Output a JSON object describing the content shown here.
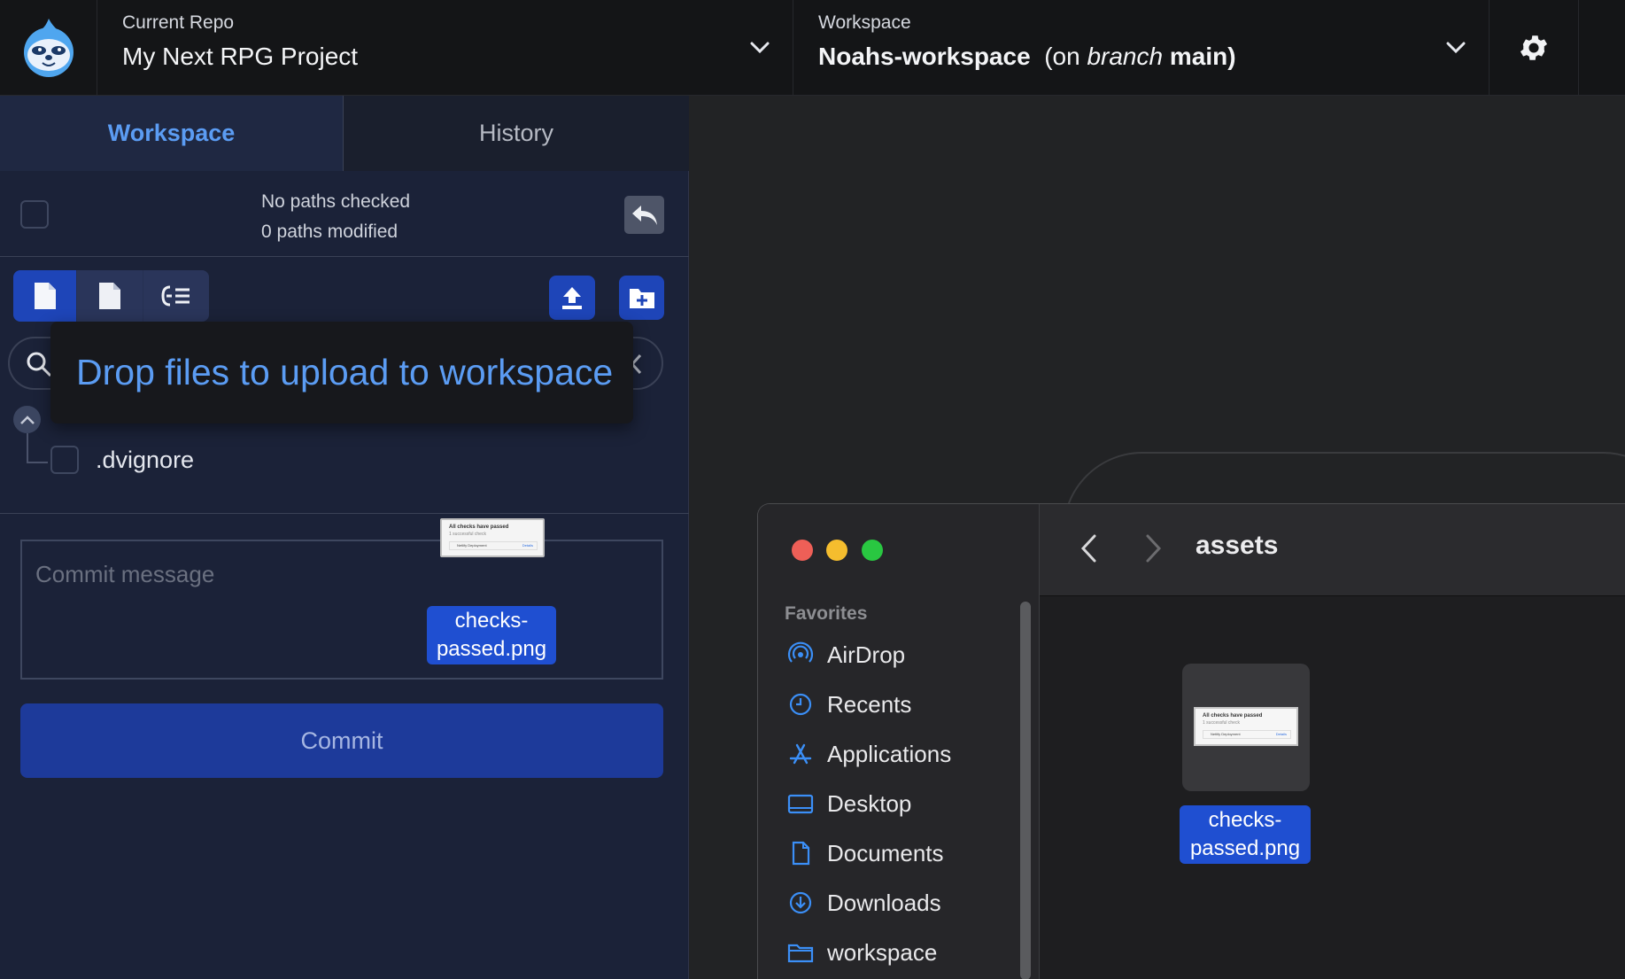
{
  "topbar": {
    "repo_label": "Current Repo",
    "repo_value": "My Next RPG Project",
    "workspace_label": "Workspace",
    "workspace_name": "Noahs-workspace",
    "workspace_branch_prefix": "(on",
    "workspace_branch_word": "branch",
    "workspace_branch_name": "main)"
  },
  "tabs": {
    "workspace": "Workspace",
    "history": "History"
  },
  "status": {
    "checked": "No paths checked",
    "modified": "0 paths modified"
  },
  "drop_overlay": {
    "text": "Drop files to upload to workspace"
  },
  "files": [
    {
      "name": ".dvignore"
    }
  ],
  "commit": {
    "placeholder": "Commit message",
    "button": "Commit"
  },
  "drag": {
    "label": "checks-passed.png"
  },
  "finder": {
    "title": "assets",
    "favorites_label": "Favorites",
    "sidebar": [
      {
        "label": "AirDrop",
        "icon": "airdrop-icon"
      },
      {
        "label": "Recents",
        "icon": "clock-icon"
      },
      {
        "label": "Applications",
        "icon": "applications-icon"
      },
      {
        "label": "Desktop",
        "icon": "desktop-icon"
      },
      {
        "label": "Documents",
        "icon": "document-icon"
      },
      {
        "label": "Downloads",
        "icon": "download-icon"
      },
      {
        "label": "workspace",
        "icon": "folder-icon"
      }
    ],
    "file": {
      "label": "checks-passed.png"
    }
  },
  "thumbnail": {
    "title": "All checks have passed",
    "subtitle": "1 successful check",
    "row": "Netlify Deployment",
    "link": "Details"
  },
  "colors": {
    "accent": "#5b9cf3",
    "button": "#1e45b8",
    "panel": "#1b2238",
    "selection": "#1f4fd1"
  }
}
